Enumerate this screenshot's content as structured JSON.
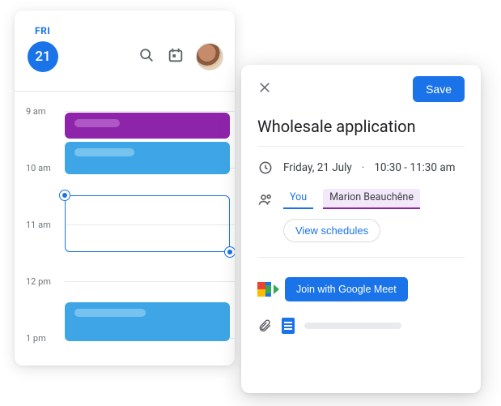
{
  "calendar": {
    "day_label": "FRI",
    "day_number": "21",
    "hours": [
      "9 am",
      "10 am",
      "11 am",
      "12 pm",
      "1 pm"
    ]
  },
  "event": {
    "save_label": "Save",
    "title": "Wholesale application",
    "date_text": "Friday, 21 July",
    "separator": "·",
    "time_text": "10:30 - 11:30 am",
    "you_label": "You",
    "guest_name": "Marion Beauchêne",
    "view_schedules_label": "View schedules",
    "meet_button_label": "Join with Google Meet"
  }
}
